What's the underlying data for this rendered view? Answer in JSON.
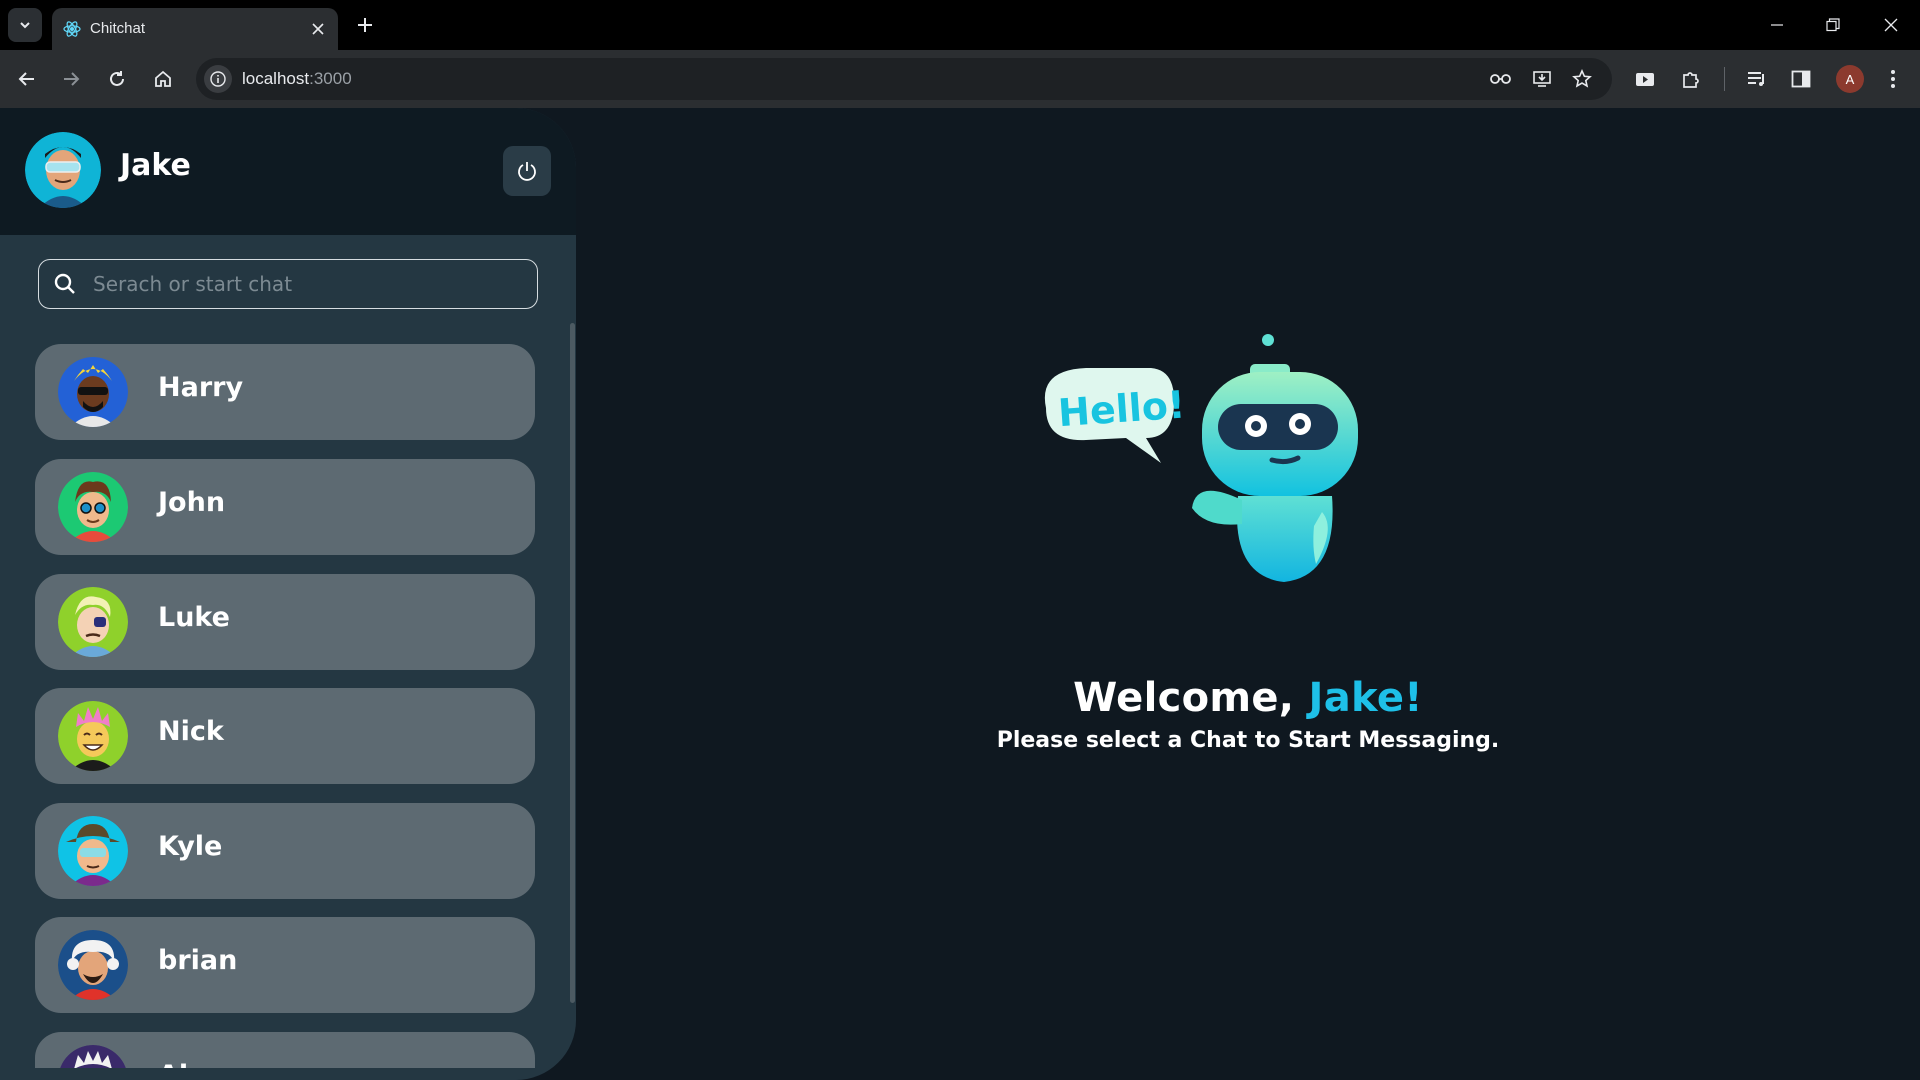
{
  "browser": {
    "tab_title": "Chitchat",
    "url_host": "localhost",
    "url_port": ":3000",
    "profile_initial": "A"
  },
  "user": {
    "name": "Jake"
  },
  "search": {
    "placeholder": "Serach or start chat"
  },
  "chats": [
    {
      "name": "Harry",
      "avatar": "avatar-harry"
    },
    {
      "name": "John",
      "avatar": "avatar-john"
    },
    {
      "name": "Luke",
      "avatar": "avatar-luke"
    },
    {
      "name": "Nick",
      "avatar": "avatar-nick"
    },
    {
      "name": "Kyle",
      "avatar": "avatar-kyle"
    },
    {
      "name": "brian",
      "avatar": "avatar-brian"
    },
    {
      "name": "Al",
      "avatar": "avatar-partial"
    }
  ],
  "welcome": {
    "greeting": "Welcome, ",
    "name": "Jake!",
    "subtitle": "Please select a Chat to Start Messaging.",
    "bubble_text": "Hello!"
  },
  "colors": {
    "accent": "#1ec0e8",
    "sidebar": "#243742",
    "background": "#0f1820",
    "chat_item": "#5d6a72"
  }
}
